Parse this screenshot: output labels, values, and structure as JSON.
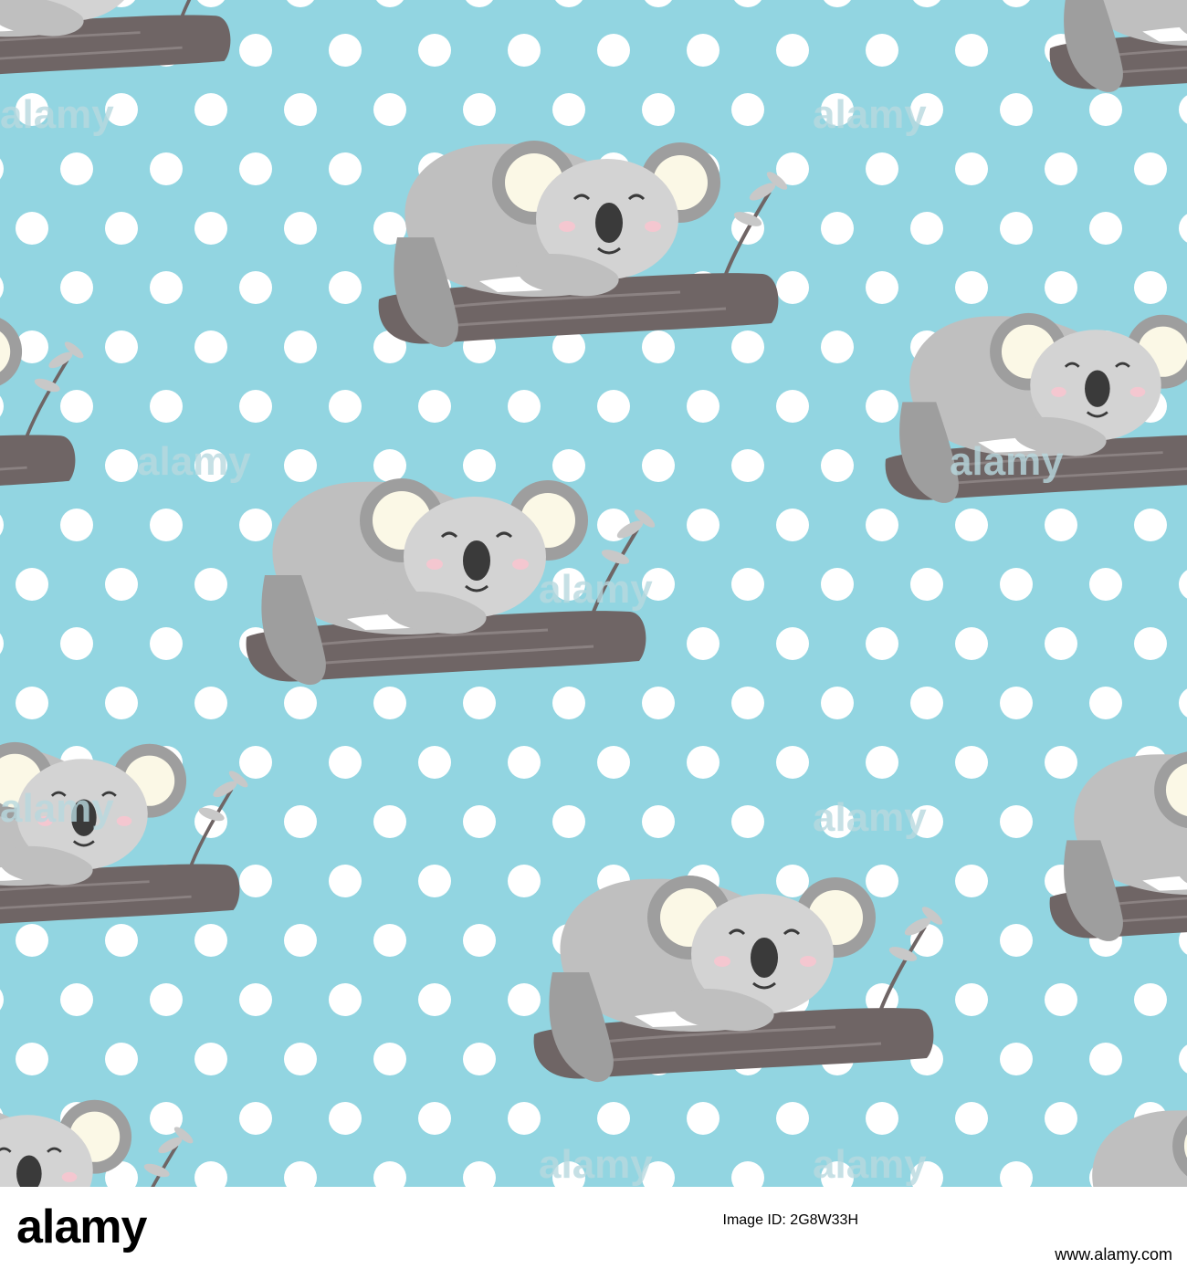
{
  "colors": {
    "background": "#92d5e1",
    "dot": "#ffffff",
    "fur": "#bfbfbf",
    "fur_dark": "#9e9e9e",
    "ear_inner": "#fbf8e6",
    "face": "#d3d3d3",
    "nose": "#3a3a3a",
    "blush": "#f4c7d0",
    "branch": "#6f6565",
    "branch_light": "#8b8282",
    "leaf": "#c8c8c8",
    "watermark": "#b8d8de"
  },
  "watermark_text": "alamy",
  "footer": {
    "logo": "alamy",
    "image_id": "Image ID: 2G8W33H",
    "stock_id": "",
    "site": "www.alamy.com"
  },
  "koalas": [
    {
      "name": "koala-top-left-partial"
    },
    {
      "name": "koala-top-center"
    },
    {
      "name": "koala-top-right-partial"
    },
    {
      "name": "koala-middle-left-partial"
    },
    {
      "name": "koala-center"
    },
    {
      "name": "koala-middle-right"
    },
    {
      "name": "koala-lower-left-partial"
    },
    {
      "name": "koala-lower-center"
    },
    {
      "name": "koala-lower-right-partial"
    },
    {
      "name": "koala-bottom-left-partial"
    },
    {
      "name": "koala-bottom-right-partial"
    }
  ]
}
